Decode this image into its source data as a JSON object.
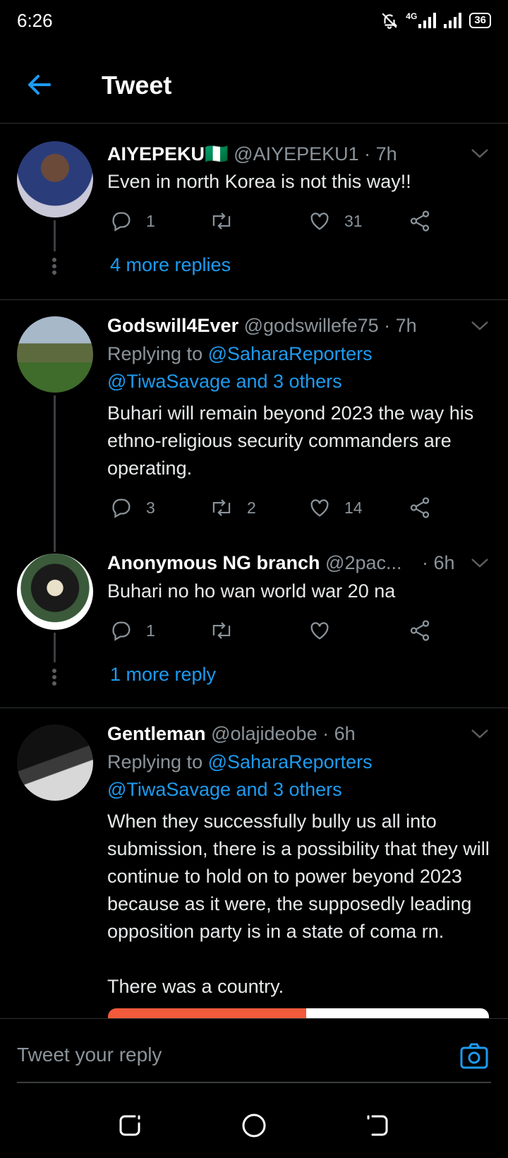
{
  "status_bar": {
    "time": "6:26",
    "network": "4G",
    "battery": "36"
  },
  "header": {
    "title": "Tweet"
  },
  "tweets": [
    {
      "name": "AIYEPEKU🇳🇬",
      "handle": "@AIYEPEKU1",
      "time": "· 7h",
      "text": "Even in north Korea is not this way!!",
      "replies": "1",
      "retweets": "",
      "likes": "31",
      "more_replies": "4 more replies"
    },
    {
      "name": "Godswill4Ever",
      "handle": "@godswillefe75",
      "time": "· 7h",
      "replying_prefix": "Replying to",
      "replying_to_1": "@SaharaReporters",
      "replying_to_2": "@TiwaSavage and 3 others",
      "text": "Buhari will remain beyond 2023 the way his ethno-religious security commanders are operating.",
      "replies": "3",
      "retweets": "2",
      "likes": "14"
    },
    {
      "name": "Anonymous NG branch",
      "handle": "@2pac...",
      "time": "· 6h",
      "text": "Buhari no ho wan world war 20 na",
      "replies": "1",
      "retweets": "",
      "likes": "",
      "more_replies": "1 more reply"
    },
    {
      "name": "Gentleman",
      "handle": "@olajideobe",
      "time": "· 6h",
      "replying_prefix": "Replying to",
      "replying_to_1": "@SaharaReporters",
      "replying_to_2": "@TiwaSavage and 3 others",
      "text": "When they successfully bully us all into submission, there is a possibility that they will continue to hold on to power beyond 2023 because as it were, the supposedly leading opposition party is in a state of coma rn.",
      "text_2": "There was a country."
    }
  ],
  "reply_box": {
    "placeholder": "Tweet your reply"
  },
  "colors": {
    "accent": "#1d9bf0",
    "background": "#000000",
    "muted": "#8b949b"
  }
}
